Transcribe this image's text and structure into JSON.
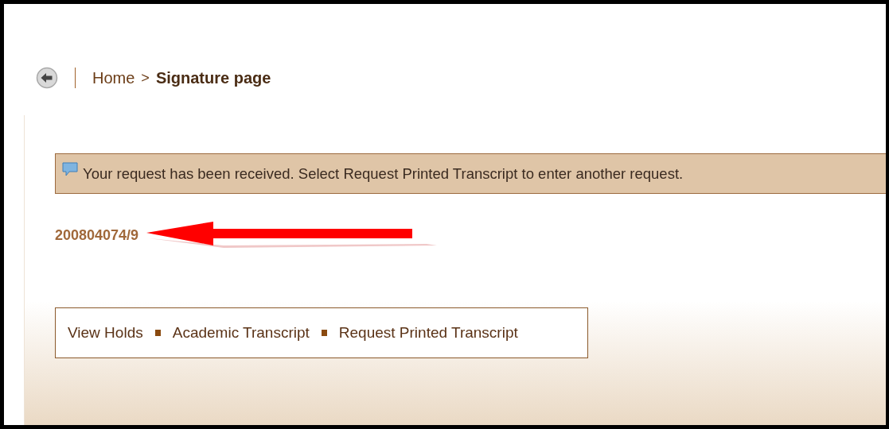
{
  "back_button": {
    "kind": "back"
  },
  "breadcrumb": [
    {
      "label": "Home",
      "current": false
    },
    {
      "label": "Signature page",
      "current": true
    }
  ],
  "breadcrumb_separator": ">",
  "message": "Your request has been received. Select Request Printed Transcript to enter another request.",
  "request_number": "200804074/9",
  "links": [
    {
      "label": "View Holds"
    },
    {
      "label": "Academic Transcript"
    },
    {
      "label": "Request Printed Transcript"
    }
  ]
}
